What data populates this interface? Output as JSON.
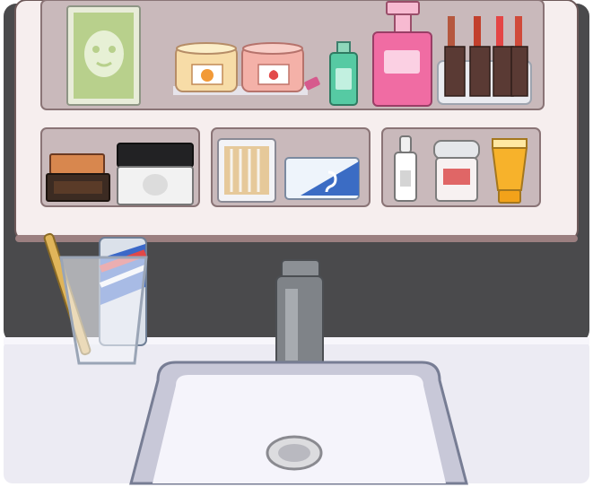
{
  "scene": {
    "title": "",
    "description_visible_text": ""
  },
  "items": {
    "face_mask": {
      "name": "face-mask-packet",
      "clickable": true
    },
    "candle_orange": {
      "name": "orange-candle",
      "clickable": true
    },
    "candle_strawberry": {
      "name": "strawberry-candle",
      "clickable": true
    },
    "perfume_green": {
      "name": "green-perfume",
      "clickable": true
    },
    "perfume_pink": {
      "name": "pink-perfume",
      "clickable": true
    },
    "lipstick_rack": {
      "name": "lipstick-rack",
      "clickable": true
    },
    "makeup_palette": {
      "name": "makeup-palette",
      "clickable": true
    },
    "cream_jar": {
      "name": "cream-jar",
      "clickable": true
    },
    "cotton_swabs": {
      "name": "cotton-swab-box",
      "clickable": true
    },
    "floss_box": {
      "name": "floss-box",
      "clickable": true
    },
    "serum_bottle": {
      "name": "serum-bottle",
      "clickable": true
    },
    "deodorant": {
      "name": "deodorant",
      "clickable": true
    },
    "yellow_tube": {
      "name": "yellow-cream-tube",
      "clickable": true
    },
    "toothbrush_cup": {
      "name": "toothbrush-cup",
      "clickable": true
    },
    "faucet": {
      "name": "faucet",
      "clickable": true
    },
    "sink": {
      "name": "sink-basin",
      "clickable": false
    },
    "drain": {
      "name": "sink-drain",
      "clickable": true
    }
  },
  "colors": {
    "wall": "#4a4a4c",
    "cabinet": "#f6eeee",
    "cabinet_inner": "#c9b9bb",
    "counter": "#ecebf3",
    "sink": "#dcdbe8",
    "outline": "#6e5a5a"
  }
}
